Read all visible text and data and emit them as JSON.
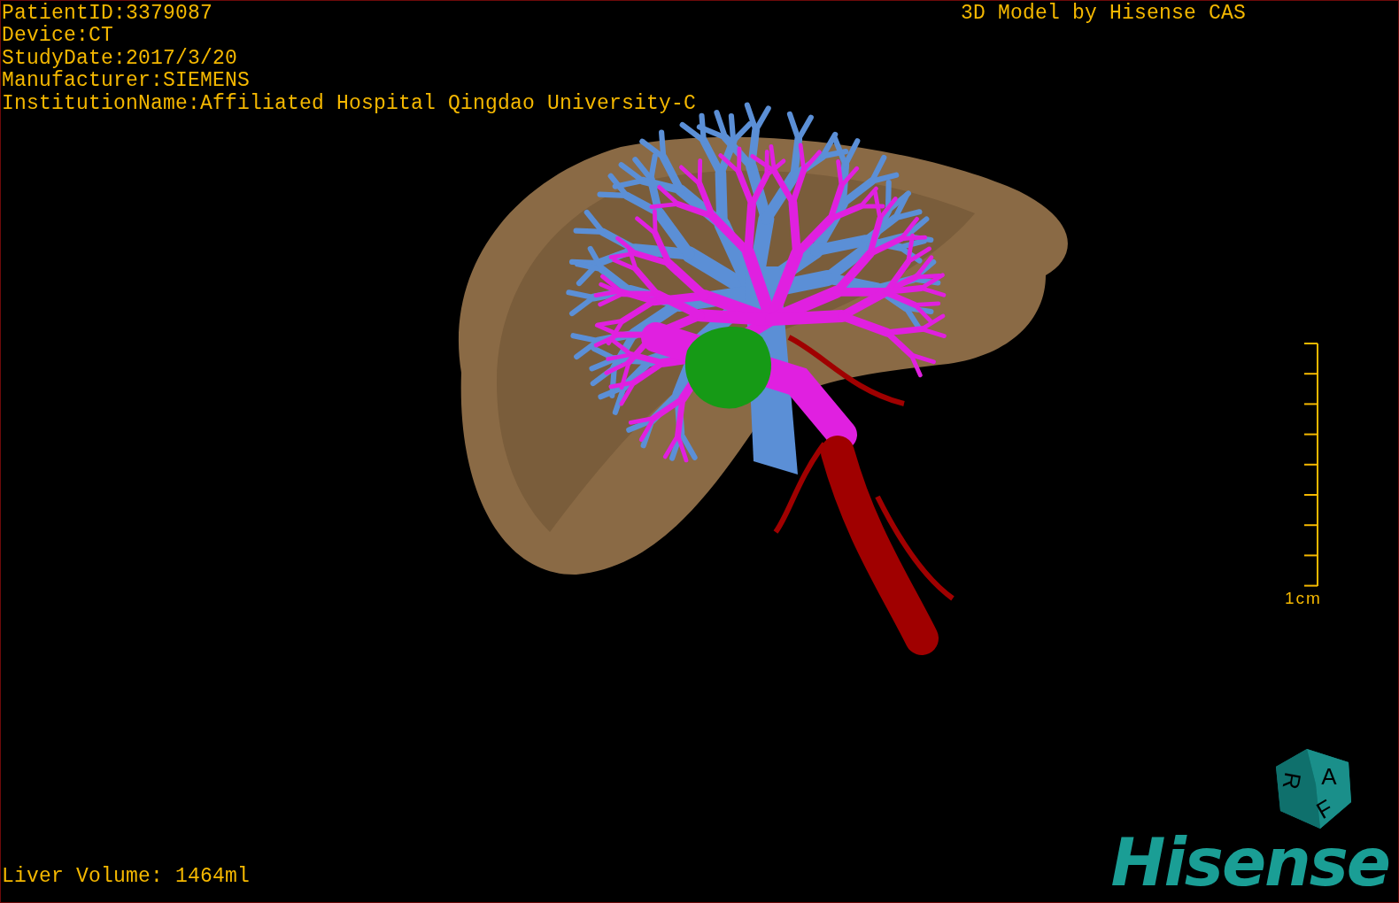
{
  "info_lines": [
    "PatientID:3379087",
    "Device:CT",
    "StudyDate:2017/3/20",
    "Manufacturer:SIEMENS",
    "InstitutionName:Affiliated Hospital Qingdao University-C"
  ],
  "credit": "3D Model by Hisense CAS",
  "scale_bar": {
    "label": "1cm"
  },
  "volume": "Liver Volume: 1464ml",
  "orientation_cube": {
    "faces": [
      "A",
      "R",
      "F"
    ]
  },
  "logo": "Hisense"
}
